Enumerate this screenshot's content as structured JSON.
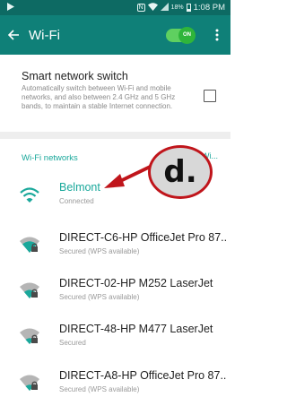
{
  "status_bar": {
    "left_icon": "play-store-notification-icon",
    "battery_text": "18%",
    "time": "1:08 PM",
    "nfc_letter": "N"
  },
  "app_bar": {
    "title": "Wi-Fi",
    "toggle_label": "ON",
    "toggle_on": true,
    "accent_color": "#0f8078",
    "status_color": "#0d6a63"
  },
  "smart_switch": {
    "title": "Smart network switch",
    "description": "Automatically switch between Wi-Fi and mobile networks, and also between 2.4 GHz and 5 GHz bands, to maintain a stable Internet connection.",
    "checked": false
  },
  "networks_section": {
    "header": "Wi-Fi networks",
    "header_more": "Wi..."
  },
  "networks": [
    {
      "name": "Belmont",
      "status": "Connected",
      "connected": true,
      "secured": false,
      "icon": "wifi-connected-icon"
    },
    {
      "name": "DIRECT-C6-HP OfficeJet Pro 87..",
      "status": "Secured (WPS available)",
      "connected": false,
      "secured": true,
      "icon": "wifi-locked-icon"
    },
    {
      "name": "DIRECT-02-HP M252 LaserJet",
      "status": "Secured (WPS available)",
      "connected": false,
      "secured": true,
      "icon": "wifi-locked-icon"
    },
    {
      "name": "DIRECT-48-HP M477 LaserJet",
      "status": "Secured",
      "connected": false,
      "secured": true,
      "icon": "wifi-locked-icon"
    },
    {
      "name": "DIRECT-A8-HP OfficeJet Pro 87..",
      "status": "Secured (WPS available)",
      "connected": false,
      "secured": true,
      "icon": "wifi-locked-icon"
    }
  ],
  "annotation": {
    "label": "d.",
    "color": "#c0151b"
  }
}
